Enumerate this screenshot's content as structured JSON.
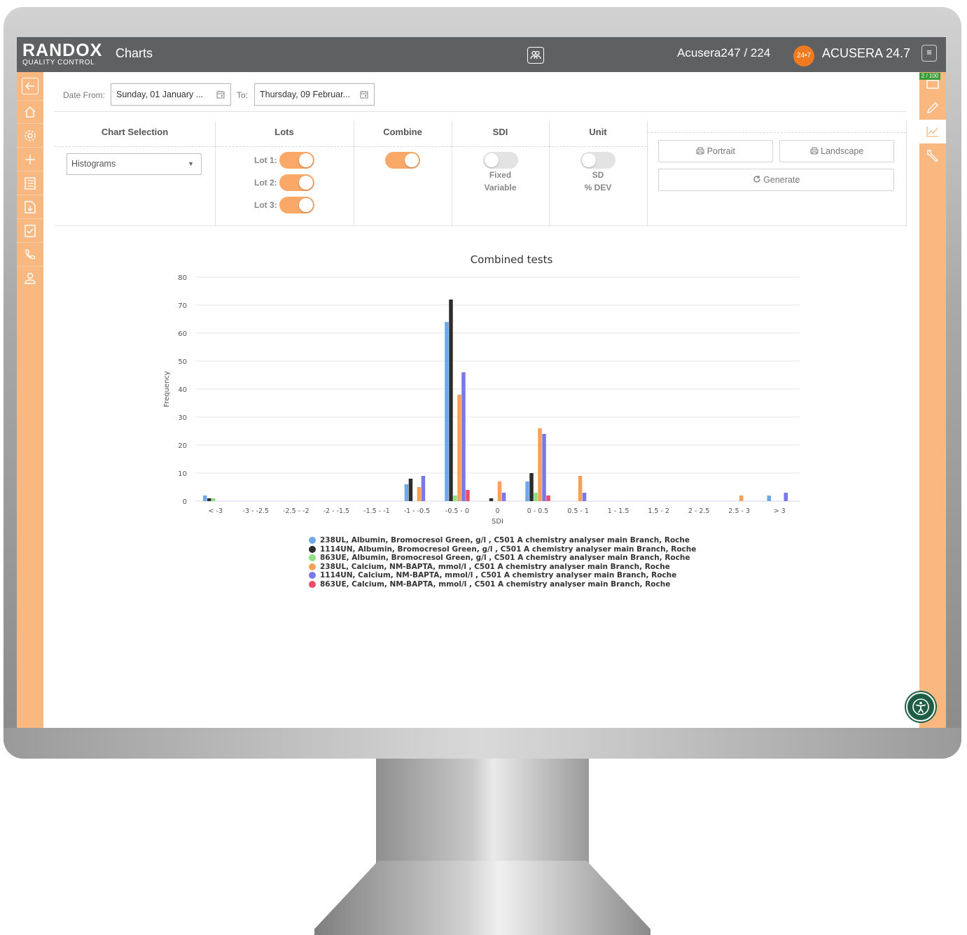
{
  "header": {
    "logo_main": "RANDOX",
    "logo_sub": "QUALITY CONTROL",
    "page_title": "Charts",
    "account": "Acusera247 / 224",
    "badge": "24•7",
    "product": "ACUSERA 24.7",
    "menu_icon": "≡"
  },
  "right_sidebar": {
    "counter": "2 / 100"
  },
  "filters": {
    "date_from_label": "Date From:",
    "date_from_value": "Sunday, 01 January ...",
    "to_label": "To:",
    "to_value": "Thursday, 09 Februar..."
  },
  "controls": {
    "chart_selection": {
      "header": "Chart Selection",
      "selected": "Histograms"
    },
    "lots": {
      "header": "Lots",
      "items": [
        {
          "label": "Lot 1:",
          "on": true
        },
        {
          "label": "Lot 2:",
          "on": true
        },
        {
          "label": "Lot 3:",
          "on": true
        }
      ]
    },
    "combine": {
      "header": "Combine",
      "on": true
    },
    "sdi": {
      "header": "SDI",
      "on": false,
      "option_a": "Fixed",
      "option_b": "Variable"
    },
    "unit": {
      "header": "Unit",
      "on": false,
      "option_a": "SD",
      "option_b": "% DEV"
    },
    "buttons": {
      "portrait": "Portrait",
      "landscape": "Landscape",
      "generate": "Generate"
    }
  },
  "chart_data": {
    "type": "bar",
    "title": "Combined tests",
    "xlabel": "SDI",
    "ylabel": "Frequency",
    "ylim": [
      0,
      80
    ],
    "yticks": [
      0,
      10,
      20,
      30,
      40,
      50,
      60,
      70,
      80
    ],
    "grid": true,
    "legend_position": "bottom",
    "categories": [
      "< -3",
      "-3 - -2.5",
      "-2.5 - -2",
      "-2 - -1.5",
      "-1.5 - -1",
      "-1 - -0.5",
      "-0.5 - 0",
      "0",
      "0 - 0.5",
      "0.5 - 1",
      "1 - 1.5",
      "1.5 - 2",
      "2 - 2.5",
      "2.5 - 3",
      "> 3"
    ],
    "series": [
      {
        "name": "238UL, Albumin, Bromocresol Green, g/l , C501 A chemistry analyser main Branch, Roche",
        "color": "#6ea8e8",
        "values": [
          2,
          0,
          0,
          0,
          0,
          6,
          64,
          0,
          7,
          0,
          0,
          0,
          0,
          0,
          2
        ]
      },
      {
        "name": "1114UN, Albumin, Bromocresol Green, g/l , C501 A chemistry analyser main Branch, Roche",
        "color": "#2d2d2d",
        "values": [
          1,
          0,
          0,
          0,
          0,
          8,
          72,
          1,
          10,
          0,
          0,
          0,
          0,
          0,
          0
        ]
      },
      {
        "name": "863UE, Albumin, Bromocresol Green, g/l , C501 A chemistry analyser main Branch, Roche",
        "color": "#8fe07e",
        "values": [
          1,
          0,
          0,
          0,
          0,
          0,
          2,
          0,
          3,
          0,
          0,
          0,
          0,
          0,
          0
        ]
      },
      {
        "name": "238UL, Calcium, NM-BAPTA, mmol/l , C501 A chemistry analyser main Branch, Roche",
        "color": "#f6a05a",
        "values": [
          0,
          0,
          0,
          0,
          0,
          5,
          38,
          7,
          26,
          9,
          0,
          0,
          0,
          2,
          0
        ]
      },
      {
        "name": "1114UN, Calcium, NM-BAPTA, mmol/l , C501 A chemistry analyser main Branch, Roche",
        "color": "#7a78e6",
        "values": [
          0,
          0,
          0,
          0,
          0,
          9,
          46,
          3,
          24,
          3,
          0,
          0,
          0,
          0,
          3
        ]
      },
      {
        "name": "863UE, Calcium, NM-BAPTA, mmol/l , C501 A chemistry analyser main Branch, Roche",
        "color": "#ee4b6a",
        "values": [
          0,
          0,
          0,
          0,
          0,
          0,
          4,
          0,
          2,
          0,
          0,
          0,
          0,
          0,
          0
        ]
      }
    ]
  },
  "colors": {
    "accent": "#f9b87f",
    "toggle_on": "#f9a867",
    "topbar": "#5f6062",
    "badge": "#f07a1d"
  }
}
